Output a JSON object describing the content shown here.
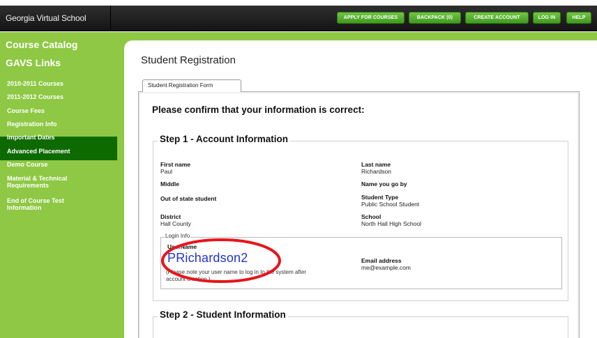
{
  "header": {
    "site_title": "Georgia Virtual School",
    "nav": [
      "APPLY FOR COURSES",
      "BACKPACK (0)",
      "CREATE ACCOUNT",
      "LOG IN",
      "HELP"
    ]
  },
  "sidebar": {
    "headings": [
      "Course Catalog",
      "GAVS Links"
    ],
    "items": [
      {
        "label": "2010-2011 Courses"
      },
      {
        "label": "2011-2012 Courses"
      },
      {
        "label": "Course Fees"
      },
      {
        "label": "Registration Info"
      },
      {
        "label": "Important Dates"
      },
      {
        "label": "Advanced Placement"
      },
      {
        "label": "Demo Course"
      },
      {
        "label": "Material & Technical Requirements",
        "lines": [
          "Material & Technical",
          "Requirements"
        ]
      },
      {
        "label": "End of Course Test Information",
        "lines": [
          "End of Course Test",
          "Information"
        ]
      }
    ]
  },
  "main": {
    "page_title": "Student Registration",
    "tab_label": "Student Registration Form",
    "confirm_heading": "Please confirm that your information is correct:",
    "step1": {
      "legend": "Step 1 - Account Information",
      "first_name_label": "First name",
      "first_name_value": "Paul",
      "last_name_label": "Last name",
      "last_name_value": "Richardson",
      "middle_label": "Middle",
      "goby_label": "Name you go by",
      "out_of_state_label": "Out of state student",
      "student_type_label": "Student Type",
      "student_type_value": "Public School Student",
      "district_label": "District",
      "district_value": "Hall County",
      "school_label": "School",
      "school_value": "North Hall High School",
      "login_legend": "Login Info",
      "username_label": "UserName",
      "username_value": "PRichardson2",
      "note_line1": "(Please note your user name to log in to the system after",
      "note_line2": "account creation.)",
      "email_label": "Email address",
      "email_value": "me@example.com"
    },
    "step2": {
      "legend": "Step 2 - Student Information"
    }
  },
  "colors": {
    "sidebar_green": "#8ec844",
    "active_green": "#0d6a00",
    "button_green": "#4fae2a",
    "topbar": "#1f1f1f",
    "username_blue": "#2133d6",
    "highlight_red": "#e8141b"
  }
}
